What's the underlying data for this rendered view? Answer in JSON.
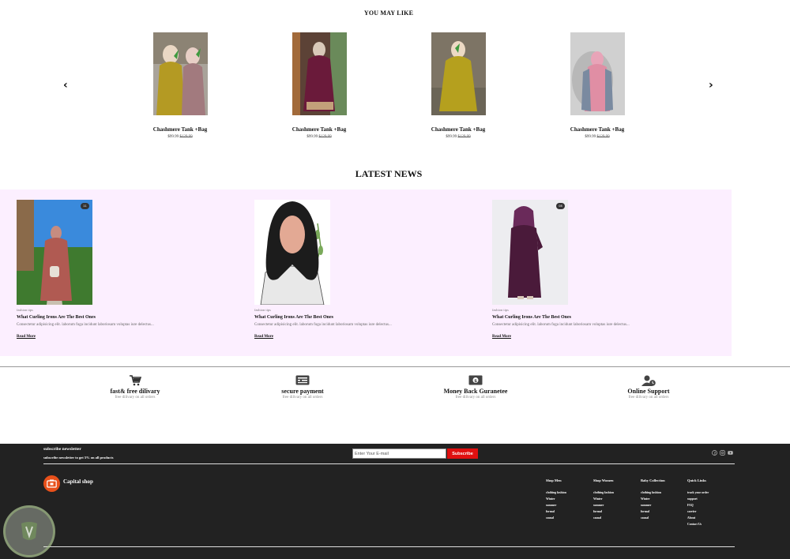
{
  "you_may_like": {
    "title": "YOU MAY LIKE",
    "products": [
      {
        "name": "Chashmere Tank +Bag",
        "price": "$99.99",
        "old_price": "$129.99"
      },
      {
        "name": "Chashmere Tank +Bag",
        "price": "$99.99",
        "old_price": "$129.99"
      },
      {
        "name": "Chashmere Tank +Bag",
        "price": "$99.99",
        "old_price": "$129.99"
      },
      {
        "name": "Chashmere Tank +Bag",
        "price": "$99.99",
        "old_price": "$129.99"
      }
    ]
  },
  "latest_news": {
    "title": "LATEST NEWS",
    "posts": [
      {
        "badge": "11",
        "category": "fashion tips",
        "headline": "What Curling Irons Are The Best Ones",
        "excerpt": "Consectetur adipisicing elit. laborum fuga incidunt laboriosam voluptas iure delectus...",
        "read_more": "Read More"
      },
      {
        "badge": "",
        "category": "fashion tips",
        "headline": "What Curling Irons Are The Best Ones",
        "excerpt": "Consectetur adipisicing elit. laborum fuga incidunt laboriosam voluptas iure delectus...",
        "read_more": "Read More"
      },
      {
        "badge": "08",
        "category": "fashion tips",
        "headline": "What Curling Irons Are The Best Ones",
        "excerpt": "Consectetur adipisicing elit. laborum fuga incidunt laboriosam voluptas iure delectus...",
        "read_more": "Read More"
      }
    ]
  },
  "features": [
    {
      "icon": "cart-icon",
      "title": "fast& free dilivary",
      "subtitle": "free dilivary on all orders"
    },
    {
      "icon": "credit-card-icon",
      "title": "secure payment",
      "subtitle": "free dilivary on all orders"
    },
    {
      "icon": "money-icon",
      "title": "Money Back Guranetee",
      "subtitle": "free dilivary on all orders"
    },
    {
      "icon": "support-icon",
      "title": "Online Support",
      "subtitle": "free dilivary on all orders"
    }
  ],
  "footer": {
    "newsletter_title": "subscribe newsletter",
    "newsletter_sub": "subscribe newsletter to get 5% on all products",
    "email_placeholder": "Enter Your E-mail",
    "subscribe_label": "Subscribe",
    "brand_name": "Capital shop",
    "columns": [
      {
        "heading": "Shop Men",
        "links": [
          "clothing fashion",
          "Winter",
          "summer",
          "formal",
          "casual"
        ]
      },
      {
        "heading": "Shop Women",
        "links": [
          "clothing fashion",
          "Winter",
          "summer",
          "formal",
          "casual"
        ]
      },
      {
        "heading": "Baby Collection",
        "links": [
          "clothing fashion",
          "Winter",
          "summer",
          "formal",
          "casual"
        ]
      },
      {
        "heading": "Quick Links",
        "links": [
          "track your order",
          "support",
          "FAQ",
          "carrier",
          "About",
          "Contact Us"
        ]
      }
    ],
    "socials": [
      "facebook-icon",
      "instagram-icon",
      "youtube-icon"
    ]
  },
  "colors": {
    "news_band": "#fcefff",
    "footer_bg": "#222222",
    "subscribe_button": "#e01010",
    "brand_logo": "#e8501a"
  }
}
